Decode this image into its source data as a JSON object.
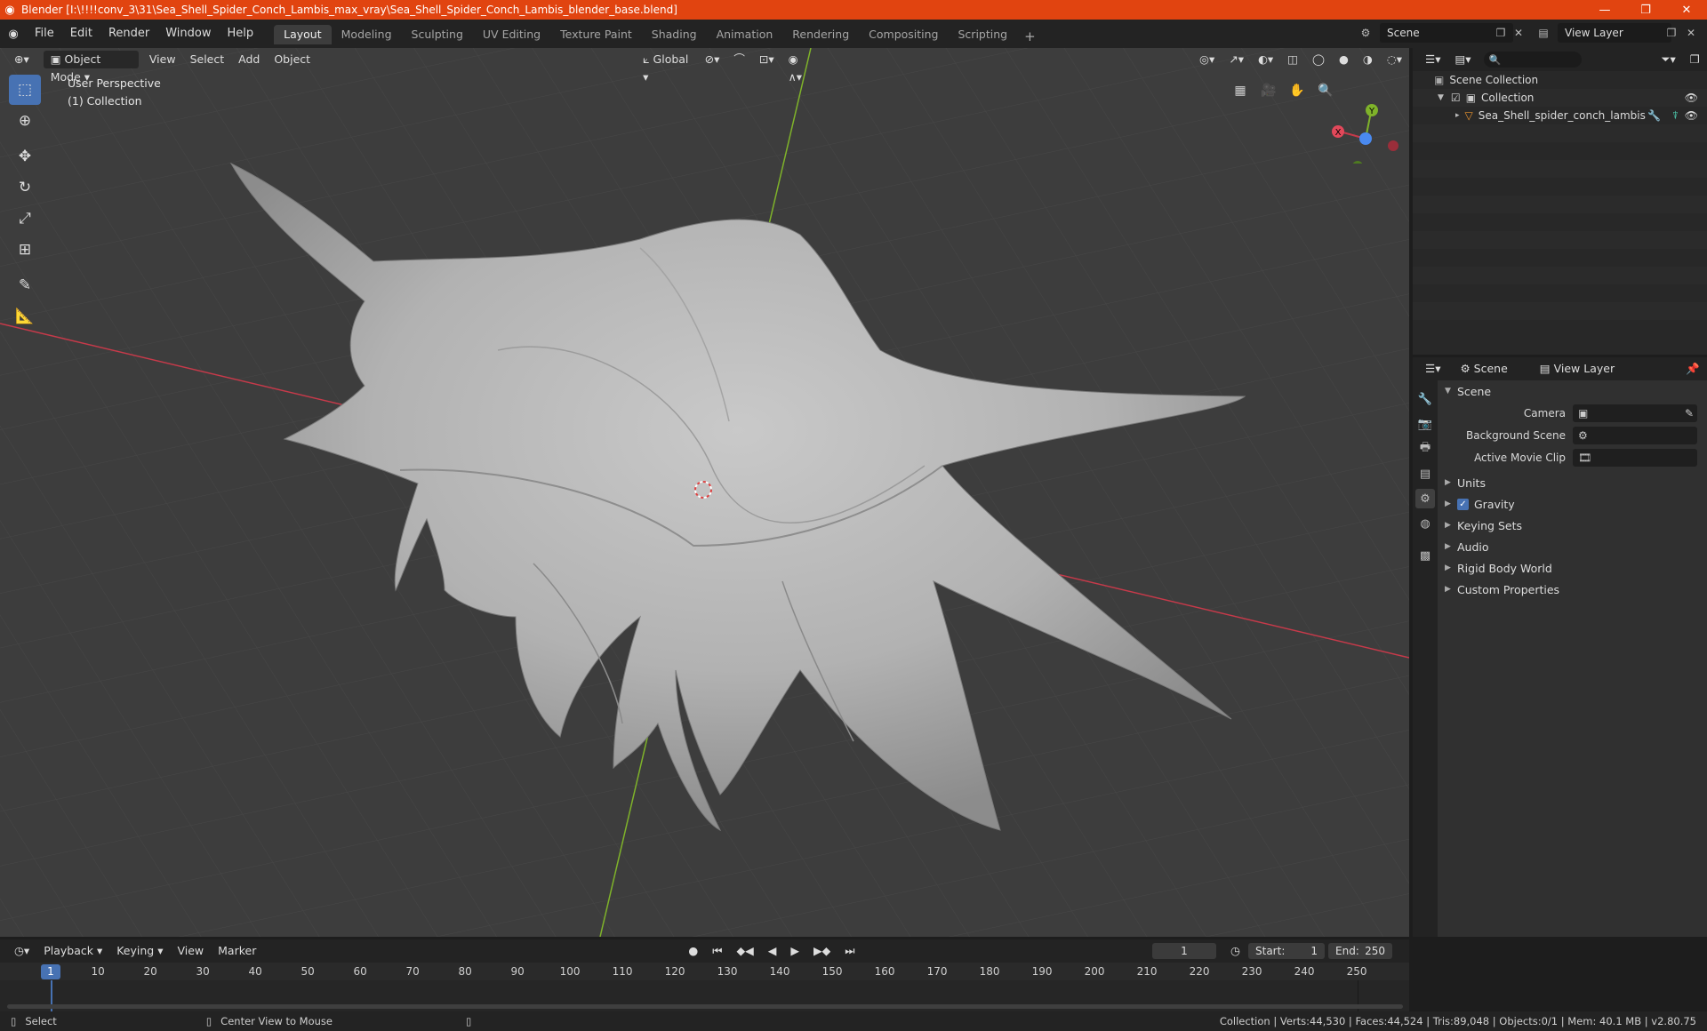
{
  "window": {
    "title": "Blender [I:\\!!!!conv_3\\31\\Sea_Shell_Spider_Conch_Lambis_max_vray\\Sea_Shell_Spider_Conch_Lambis_blender_base.blend]",
    "minimize": "—",
    "maximize": "❐",
    "close": "✕"
  },
  "menu": [
    "File",
    "Edit",
    "Render",
    "Window",
    "Help"
  ],
  "workspaces": [
    {
      "label": "Layout",
      "active": true
    },
    {
      "label": "Modeling",
      "active": false
    },
    {
      "label": "Sculpting",
      "active": false
    },
    {
      "label": "UV Editing",
      "active": false
    },
    {
      "label": "Texture Paint",
      "active": false
    },
    {
      "label": "Shading",
      "active": false
    },
    {
      "label": "Animation",
      "active": false
    },
    {
      "label": "Rendering",
      "active": false
    },
    {
      "label": "Compositing",
      "active": false
    },
    {
      "label": "Scripting",
      "active": false
    }
  ],
  "workspace_add": "+",
  "scene_selector": "Scene",
  "view_layer_selector": "View Layer",
  "viewport": {
    "mode": "Object Mode",
    "menus": [
      "View",
      "Select",
      "Add",
      "Object"
    ],
    "orientation": "Global",
    "perspective_label": "User Perspective",
    "collection_label": "(1) Collection",
    "gizmo": {
      "x": "X",
      "y": "Y"
    }
  },
  "outliner": {
    "rows": [
      {
        "label": "Scene Collection"
      },
      {
        "label": "Collection"
      },
      {
        "label": "Sea_Shell_spider_conch_lambis"
      }
    ]
  },
  "properties": {
    "tab_scene": "Scene",
    "tab_view_layer": "View Layer",
    "panel_title": "Scene",
    "camera_label": "Camera",
    "background_scene_label": "Background Scene",
    "active_movie_clip_label": "Active Movie Clip",
    "sections": [
      "Units",
      "Gravity",
      "Keying Sets",
      "Audio",
      "Rigid Body World",
      "Custom Properties"
    ]
  },
  "timeline": {
    "menus": [
      "Playback",
      "Keying",
      "View",
      "Marker"
    ],
    "current_frame": "1",
    "start_label": "Start:",
    "start": "1",
    "end_label": "End:",
    "end": "250",
    "ruler": [
      "1",
      "10",
      "20",
      "30",
      "40",
      "50",
      "60",
      "70",
      "80",
      "90",
      "100",
      "110",
      "120",
      "130",
      "140",
      "150",
      "160",
      "170",
      "180",
      "190",
      "200",
      "210",
      "220",
      "230",
      "240",
      "250"
    ]
  },
  "statusbar": {
    "left": "Select",
    "middle": "Center View to Mouse",
    "right": "Collection | Verts:44,530 | Faces:44,524 | Tris:89,048 | Objects:0/1 | Mem: 40.1 MB | v2.80.75"
  },
  "colors": {
    "title_bar": "#e14410",
    "accent": "#4772b3",
    "x_axis": "#c63a4a",
    "y_axis": "#7fb32a"
  }
}
